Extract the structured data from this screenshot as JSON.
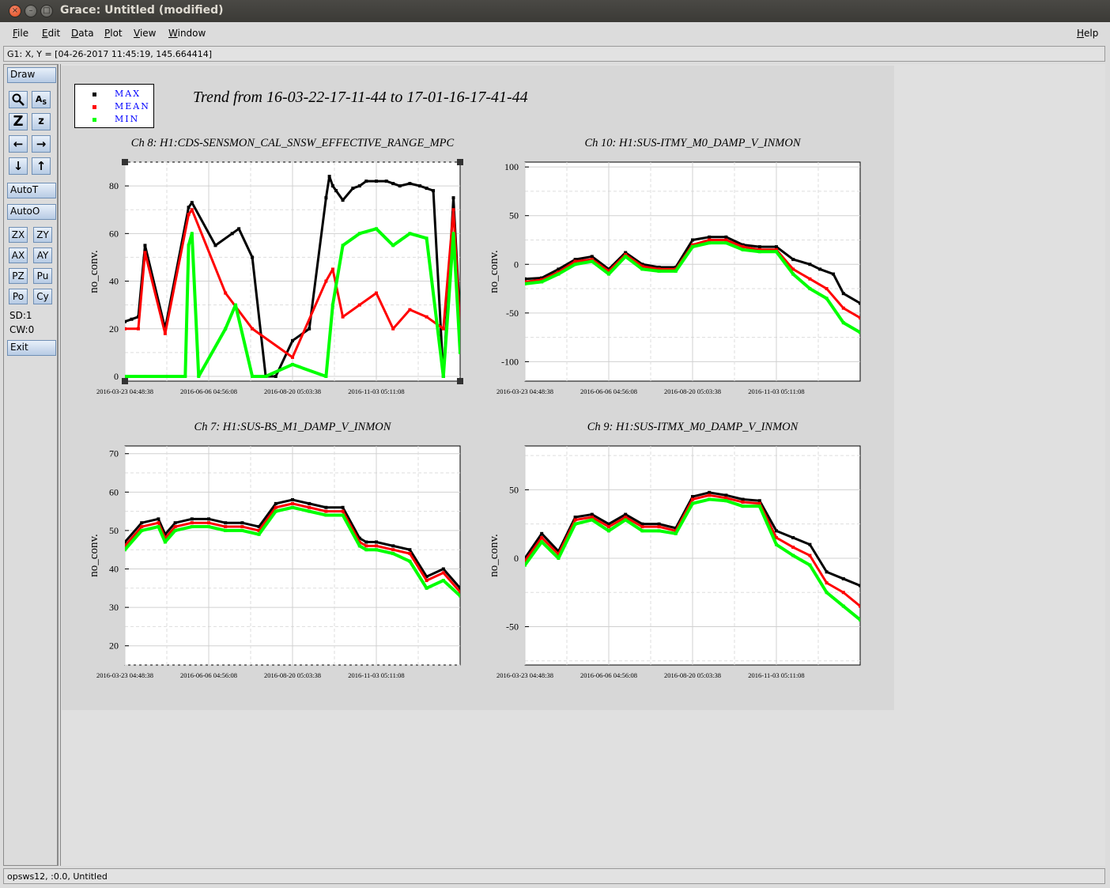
{
  "window": {
    "title": "Grace: Untitled (modified)",
    "controls": [
      "close-icon",
      "minimize-icon",
      "maximize-icon"
    ]
  },
  "menubar": {
    "items": [
      {
        "label": "File",
        "u": "F",
        "rest": "ile"
      },
      {
        "label": "Edit",
        "u": "E",
        "rest": "dit"
      },
      {
        "label": "Data",
        "u": "D",
        "rest": "ata"
      },
      {
        "label": "Plot",
        "u": "P",
        "rest": "lot"
      },
      {
        "label": "View",
        "u": "V",
        "rest": "iew"
      },
      {
        "label": "Window",
        "u": "W",
        "rest": "indow"
      }
    ],
    "help": {
      "label": "Help",
      "u": "H",
      "rest": "elp"
    }
  },
  "locator": "G1: X, Y = [04-26-2017 11:45:19, 145.664414]",
  "toolbar": {
    "draw": "Draw",
    "zoom_icon": "magnifier-icon",
    "text_icon": "text-a-icon",
    "autoscale_icon": "autoscale-z-icon",
    "zoom_small_icon": "zoom-z-icon",
    "arrows": [
      "arrow-left-icon",
      "arrow-right-icon",
      "arrow-down-icon",
      "arrow-up-icon"
    ],
    "autot": "AutoT",
    "autoo": "AutoO",
    "pairs": [
      [
        "ZX",
        "ZY"
      ],
      [
        "AX",
        "AY"
      ],
      [
        "PZ",
        "Pu"
      ],
      [
        "Po",
        "Cy"
      ]
    ],
    "sd": "SD:1",
    "cw": "CW:0",
    "exit": "Exit"
  },
  "status": "opsws12, :0.0, Untitled",
  "colors": {
    "max": "#000000",
    "mean": "#ff0000",
    "min": "#00ff00",
    "legend_text": "#0000ff"
  },
  "legend": [
    {
      "label": "MAX",
      "color": "#000000"
    },
    {
      "label": "MEAN",
      "color": "#ff0000"
    },
    {
      "label": "MIN",
      "color": "#00ff00"
    }
  ],
  "main_title": "Trend from 16-03-22-17-11-44 to 17-01-16-17-41-44",
  "chart_data": [
    {
      "type": "scatter",
      "title": "Ch 8: H1:CDS-SENSMON_CAL_SNSW_EFFECTIVE_RANGE_MPC",
      "ylabel": "no_conv.",
      "ylim": [
        -2,
        90
      ],
      "yticks": [
        0,
        20,
        40,
        60,
        80
      ],
      "xticks": [
        "2016-03-23 04:48:38",
        "2016-06-06 04:56:08",
        "2016-08-20 05:03:38",
        "2016-11-03 05:11:08"
      ],
      "grid": true,
      "series": [
        {
          "name": "MAX",
          "x": [
            0,
            0.02,
            0.04,
            0.06,
            0.12,
            0.19,
            0.2,
            0.27,
            0.32,
            0.34,
            0.38,
            0.42,
            0.45,
            0.5,
            0.55,
            0.6,
            0.61,
            0.62,
            0.63,
            0.65,
            0.68,
            0.7,
            0.72,
            0.75,
            0.78,
            0.8,
            0.82,
            0.85,
            0.88,
            0.9,
            0.92,
            0.95,
            0.98,
            1.0
          ],
          "y": [
            23,
            24,
            25,
            55,
            20,
            71,
            73,
            55,
            60,
            62,
            50,
            0,
            0,
            15,
            20,
            75,
            84,
            80,
            78,
            74,
            79,
            80,
            82,
            82,
            82,
            81,
            80,
            81,
            80,
            79,
            78,
            0,
            75,
            23
          ]
        },
        {
          "name": "MEAN",
          "x": [
            0,
            0.04,
            0.06,
            0.12,
            0.19,
            0.2,
            0.3,
            0.38,
            0.5,
            0.6,
            0.62,
            0.65,
            0.7,
            0.75,
            0.8,
            0.85,
            0.9,
            0.95,
            0.98,
            1.0
          ],
          "y": [
            20,
            20,
            52,
            18,
            68,
            70,
            35,
            20,
            8,
            40,
            45,
            25,
            30,
            35,
            20,
            28,
            25,
            20,
            70,
            20
          ]
        },
        {
          "name": "MIN",
          "x": [
            0,
            0.03,
            0.06,
            0.12,
            0.18,
            0.19,
            0.2,
            0.22,
            0.3,
            0.33,
            0.38,
            0.42,
            0.5,
            0.6,
            0.62,
            0.65,
            0.7,
            0.75,
            0.8,
            0.85,
            0.9,
            0.95,
            0.98,
            1.0
          ],
          "y": [
            0,
            0,
            0,
            0,
            0,
            55,
            60,
            0,
            20,
            30,
            0,
            0,
            5,
            0,
            30,
            55,
            60,
            62,
            55,
            60,
            58,
            0,
            60,
            10
          ]
        }
      ]
    },
    {
      "type": "scatter",
      "title": "Ch 10: H1:SUS-ITMY_M0_DAMP_V_INMON",
      "ylabel": "no_conv.",
      "ylim": [
        -120,
        105
      ],
      "yticks": [
        -100,
        -50,
        0,
        50,
        100
      ],
      "xticks": [
        "2016-03-23 04:48:38",
        "2016-06-06 04:56:08",
        "2016-08-20 05:03:38",
        "2016-11-03 05:11:08"
      ],
      "grid": true,
      "series": [
        {
          "name": "MAX",
          "x": [
            0,
            0.05,
            0.1,
            0.15,
            0.2,
            0.25,
            0.3,
            0.35,
            0.4,
            0.45,
            0.5,
            0.55,
            0.6,
            0.65,
            0.7,
            0.75,
            0.8,
            0.85,
            0.88,
            0.92,
            0.95,
            1.0
          ],
          "y": [
            -15,
            -14,
            -5,
            5,
            8,
            -5,
            12,
            0,
            -3,
            -3,
            25,
            28,
            28,
            20,
            18,
            18,
            5,
            0,
            -5,
            -10,
            -30,
            -40
          ]
        },
        {
          "name": "MEAN",
          "x": [
            0,
            0.05,
            0.1,
            0.15,
            0.2,
            0.25,
            0.3,
            0.35,
            0.4,
            0.45,
            0.5,
            0.55,
            0.6,
            0.65,
            0.7,
            0.75,
            0.8,
            0.85,
            0.9,
            0.95,
            1.0
          ],
          "y": [
            -18,
            -16,
            -8,
            3,
            5,
            -7,
            10,
            -2,
            -5,
            -5,
            20,
            25,
            25,
            18,
            15,
            15,
            -5,
            -15,
            -25,
            -45,
            -55
          ]
        },
        {
          "name": "MIN",
          "x": [
            0,
            0.05,
            0.1,
            0.15,
            0.2,
            0.25,
            0.3,
            0.35,
            0.4,
            0.45,
            0.5,
            0.55,
            0.6,
            0.65,
            0.7,
            0.75,
            0.8,
            0.85,
            0.9,
            0.95,
            1.0
          ],
          "y": [
            -20,
            -18,
            -10,
            0,
            3,
            -10,
            8,
            -5,
            -7,
            -7,
            18,
            22,
            22,
            15,
            13,
            13,
            -10,
            -25,
            -35,
            -60,
            -70
          ]
        }
      ]
    },
    {
      "type": "scatter",
      "title": "Ch 7: H1:SUS-BS_M1_DAMP_V_INMON",
      "ylabel": "no_conv.",
      "ylim": [
        15,
        72
      ],
      "yticks": [
        20,
        30,
        40,
        50,
        60,
        70
      ],
      "xticks": [
        "2016-03-23 04:48:38",
        "2016-06-06 04:56:08",
        "2016-08-20 05:03:38",
        "2016-11-03 05:11:08"
      ],
      "grid": true,
      "series": [
        {
          "name": "MAX",
          "x": [
            0,
            0.05,
            0.1,
            0.12,
            0.15,
            0.2,
            0.25,
            0.3,
            0.35,
            0.4,
            0.45,
            0.5,
            0.55,
            0.6,
            0.65,
            0.7,
            0.72,
            0.75,
            0.8,
            0.85,
            0.9,
            0.95,
            1.0
          ],
          "y": [
            47,
            52,
            53,
            49,
            52,
            53,
            53,
            52,
            52,
            51,
            57,
            58,
            57,
            56,
            56,
            48,
            47,
            47,
            46,
            45,
            38,
            40,
            35
          ]
        },
        {
          "name": "MEAN",
          "x": [
            0,
            0.05,
            0.1,
            0.12,
            0.15,
            0.2,
            0.25,
            0.3,
            0.35,
            0.4,
            0.45,
            0.5,
            0.55,
            0.6,
            0.65,
            0.7,
            0.72,
            0.75,
            0.8,
            0.85,
            0.9,
            0.95,
            1.0
          ],
          "y": [
            46,
            51,
            52,
            48,
            51,
            52,
            52,
            51,
            51,
            50,
            56,
            57,
            56,
            55,
            55,
            47,
            46,
            46,
            45,
            44,
            37,
            39,
            34
          ]
        },
        {
          "name": "MIN",
          "x": [
            0,
            0.05,
            0.1,
            0.12,
            0.15,
            0.2,
            0.25,
            0.3,
            0.35,
            0.4,
            0.45,
            0.5,
            0.55,
            0.6,
            0.65,
            0.7,
            0.72,
            0.75,
            0.8,
            0.85,
            0.9,
            0.95,
            1.0
          ],
          "y": [
            45,
            50,
            51,
            47,
            50,
            51,
            51,
            50,
            50,
            49,
            55,
            56,
            55,
            54,
            54,
            46,
            45,
            45,
            44,
            42,
            35,
            37,
            33
          ]
        }
      ]
    },
    {
      "type": "scatter",
      "title": "Ch 9: H1:SUS-ITMX_M0_DAMP_V_INMON",
      "ylabel": "no_conv.",
      "ylim": [
        -78,
        82
      ],
      "yticks": [
        -50,
        0,
        50
      ],
      "xticks": [
        "2016-03-23 04:48:38",
        "2016-06-06 04:56:08",
        "2016-08-20 05:03:38",
        "2016-11-03 05:11:08"
      ],
      "grid": true,
      "series": [
        {
          "name": "MAX",
          "x": [
            0,
            0.05,
            0.1,
            0.15,
            0.2,
            0.25,
            0.3,
            0.35,
            0.4,
            0.45,
            0.5,
            0.55,
            0.6,
            0.65,
            0.7,
            0.75,
            0.8,
            0.85,
            0.9,
            0.95,
            1.0
          ],
          "y": [
            0,
            18,
            5,
            30,
            32,
            25,
            32,
            25,
            25,
            22,
            45,
            48,
            46,
            43,
            42,
            20,
            15,
            10,
            -10,
            -15,
            -20
          ]
        },
        {
          "name": "MEAN",
          "x": [
            0,
            0.05,
            0.1,
            0.15,
            0.2,
            0.25,
            0.3,
            0.35,
            0.4,
            0.45,
            0.5,
            0.55,
            0.6,
            0.65,
            0.7,
            0.75,
            0.8,
            0.85,
            0.9,
            0.95,
            1.0
          ],
          "y": [
            -2,
            15,
            3,
            28,
            30,
            23,
            30,
            23,
            23,
            20,
            43,
            46,
            44,
            41,
            40,
            15,
            8,
            2,
            -18,
            -25,
            -35
          ]
        },
        {
          "name": "MIN",
          "x": [
            0,
            0.05,
            0.1,
            0.15,
            0.2,
            0.25,
            0.3,
            0.35,
            0.4,
            0.45,
            0.5,
            0.55,
            0.6,
            0.65,
            0.7,
            0.75,
            0.8,
            0.85,
            0.9,
            0.95,
            1.0
          ],
          "y": [
            -5,
            12,
            0,
            25,
            28,
            20,
            28,
            20,
            20,
            18,
            40,
            43,
            42,
            38,
            38,
            10,
            2,
            -5,
            -25,
            -35,
            -45
          ]
        }
      ]
    }
  ]
}
